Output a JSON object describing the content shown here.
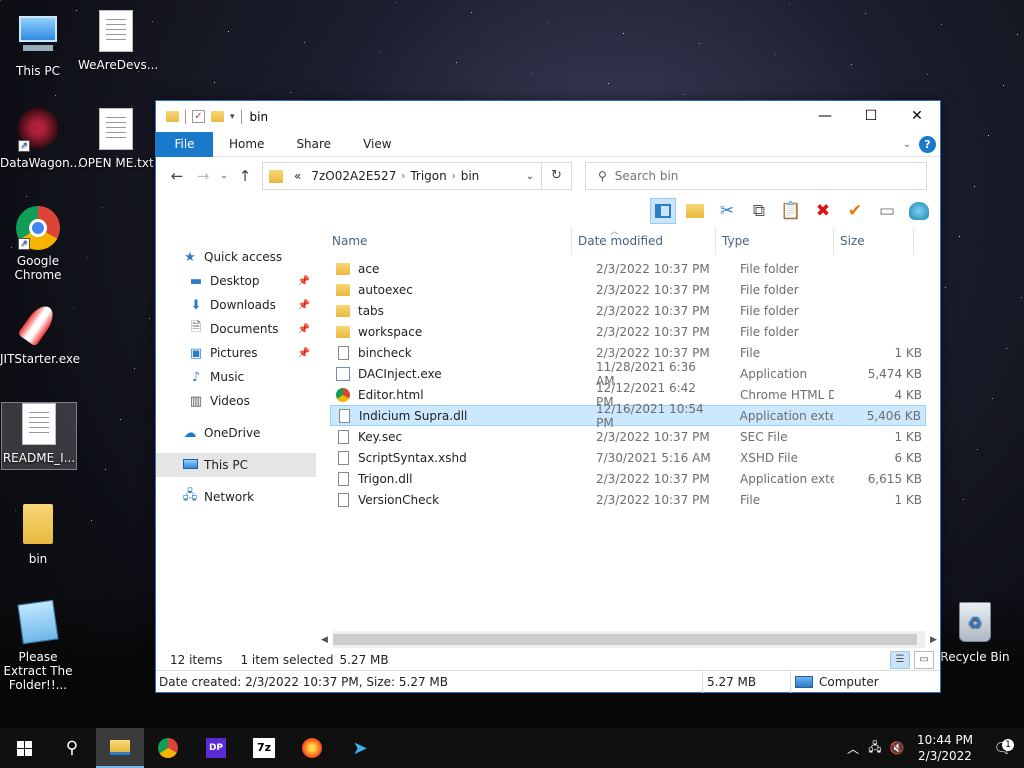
{
  "desktop": {
    "icons": [
      {
        "label": "This PC",
        "icon": "this-pc-icon"
      },
      {
        "label": "WeAreDevs...",
        "icon": "settings-file-icon"
      },
      {
        "label": "DataWagon...",
        "icon": "datawagon-icon"
      },
      {
        "label": "OPEN ME.txt",
        "icon": "text-file-icon"
      },
      {
        "label": "Google Chrome",
        "icon": "chrome-icon"
      },
      {
        "label": "JITStarter.exe",
        "icon": "rocket-icon"
      },
      {
        "label": "README_I...",
        "icon": "text-file-icon"
      },
      {
        "label": "bin",
        "icon": "folder-icon"
      },
      {
        "label": "Please Extract The Folder!!...",
        "icon": "notepad-icon"
      },
      {
        "label": "Recycle Bin",
        "icon": "recycle-bin-icon"
      }
    ]
  },
  "window": {
    "title": "bin",
    "ribbon_tabs": {
      "file": "File",
      "home": "Home",
      "share": "Share",
      "view": "View"
    },
    "help": "?",
    "address": {
      "crumb_prefix": "«",
      "crumbs": [
        "7zO02A2E527",
        "Trigon",
        "bin"
      ]
    },
    "search_placeholder": "Search bin",
    "nav": {
      "quick_access": "Quick access",
      "desktop": "Desktop",
      "downloads": "Downloads",
      "documents": "Documents",
      "pictures": "Pictures",
      "music": "Music",
      "videos": "Videos",
      "onedrive": "OneDrive",
      "this_pc": "This PC",
      "network": "Network"
    },
    "columns": {
      "name": "Name",
      "date": "Date modified",
      "type": "Type",
      "size": "Size"
    },
    "files": [
      {
        "name": "ace",
        "date": "2/3/2022 10:37 PM",
        "type": "File folder",
        "size": "",
        "icon": "folder-icon"
      },
      {
        "name": "autoexec",
        "date": "2/3/2022 10:37 PM",
        "type": "File folder",
        "size": "",
        "icon": "folder-icon"
      },
      {
        "name": "tabs",
        "date": "2/3/2022 10:37 PM",
        "type": "File folder",
        "size": "",
        "icon": "folder-icon"
      },
      {
        "name": "workspace",
        "date": "2/3/2022 10:37 PM",
        "type": "File folder",
        "size": "",
        "icon": "folder-icon"
      },
      {
        "name": "bincheck",
        "date": "2/3/2022 10:37 PM",
        "type": "File",
        "size": "1 KB",
        "icon": "file-icon"
      },
      {
        "name": "DACInject.exe",
        "date": "11/28/2021 6:36 AM",
        "type": "Application",
        "size": "5,474 KB",
        "icon": "exe-icon"
      },
      {
        "name": "Editor.html",
        "date": "12/12/2021 6:42 PM",
        "type": "Chrome HTML Do...",
        "size": "4 KB",
        "icon": "chrome-icon"
      },
      {
        "name": "Indicium Supra.dll",
        "date": "12/16/2021 10:54 PM",
        "type": "Application exten...",
        "size": "5,406 KB",
        "icon": "dll-icon"
      },
      {
        "name": "Key.sec",
        "date": "2/3/2022 10:37 PM",
        "type": "SEC File",
        "size": "1 KB",
        "icon": "file-icon"
      },
      {
        "name": "ScriptSyntax.xshd",
        "date": "7/30/2021 5:16 AM",
        "type": "XSHD File",
        "size": "6 KB",
        "icon": "file-icon"
      },
      {
        "name": "Trigon.dll",
        "date": "2/3/2022 10:37 PM",
        "type": "Application exten...",
        "size": "6,615 KB",
        "icon": "dll-icon"
      },
      {
        "name": "VersionCheck",
        "date": "2/3/2022 10:37 PM",
        "type": "File",
        "size": "1 KB",
        "icon": "file-icon"
      }
    ],
    "status": {
      "items": "12 items",
      "selected": "1 item selected",
      "selected_size": "5.27 MB"
    },
    "details": {
      "info": "Date created: 2/3/2022 10:37 PM, Size: 5.27 MB",
      "size": "5.27 MB",
      "location": "Computer"
    }
  },
  "taskbar": {
    "clock_time": "10:44 PM",
    "clock_date": "2/3/2022",
    "notification_count": "1"
  }
}
